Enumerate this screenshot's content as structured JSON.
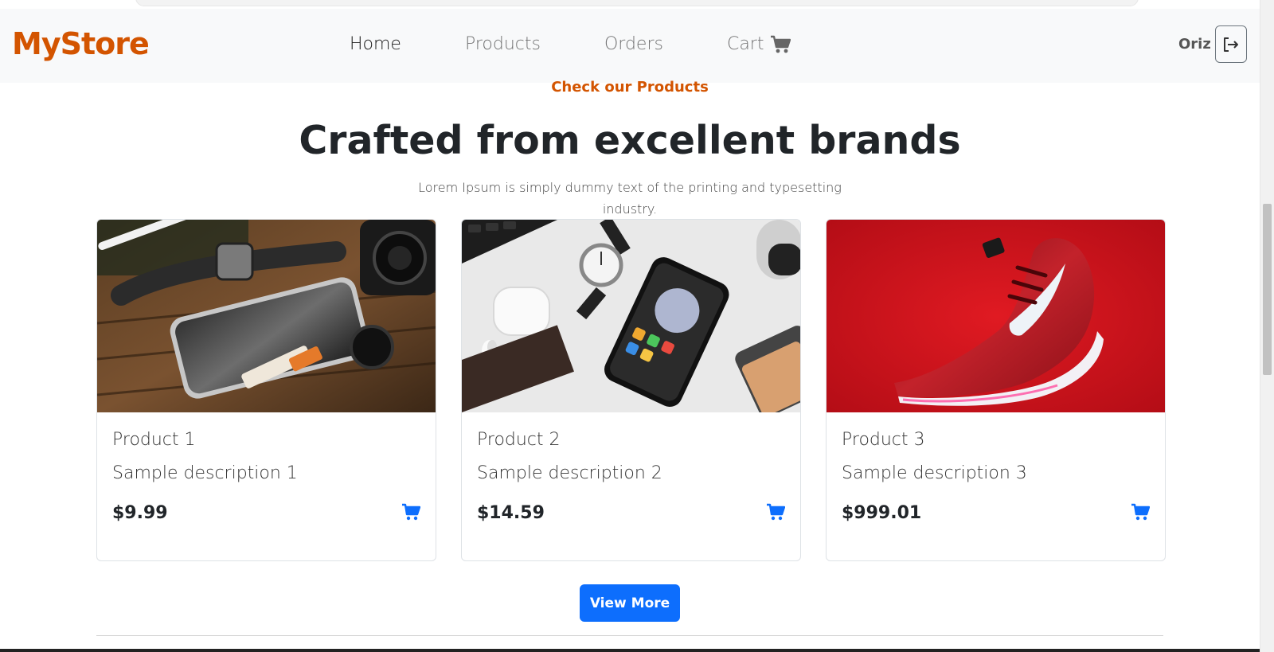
{
  "navbar": {
    "brand": "MyStore",
    "links": [
      {
        "label": "Home",
        "active": true
      },
      {
        "label": "Products",
        "active": false
      },
      {
        "label": "Orders",
        "active": false
      },
      {
        "label": "Cart",
        "active": false,
        "icon": "cart-icon"
      }
    ],
    "user_name": "Oriz",
    "logout_icon": "logout-icon"
  },
  "hero": {
    "eyebrow": "Check our Products",
    "headline": "Crafted from excellent brands",
    "lead": "Lorem Ipsum is simply dummy text of the printing and typesetting industry."
  },
  "products": [
    {
      "title": "Product 1",
      "description": "Sample description 1",
      "price": "$9.99",
      "image": "phone-watch-camera-on-wood"
    },
    {
      "title": "Product 2",
      "description": "Sample description 2",
      "price": "$14.59",
      "image": "phone-earbuds-watch-on-white"
    },
    {
      "title": "Product 3",
      "description": "Sample description 3",
      "price": "$999.01",
      "image": "red-sneaker-on-red"
    }
  ],
  "actions": {
    "view_more_label": "View More"
  },
  "colors": {
    "brand": "#d35400",
    "primary": "#0d6efd",
    "navbar_bg": "#f8f9fa",
    "text": "#212529"
  }
}
